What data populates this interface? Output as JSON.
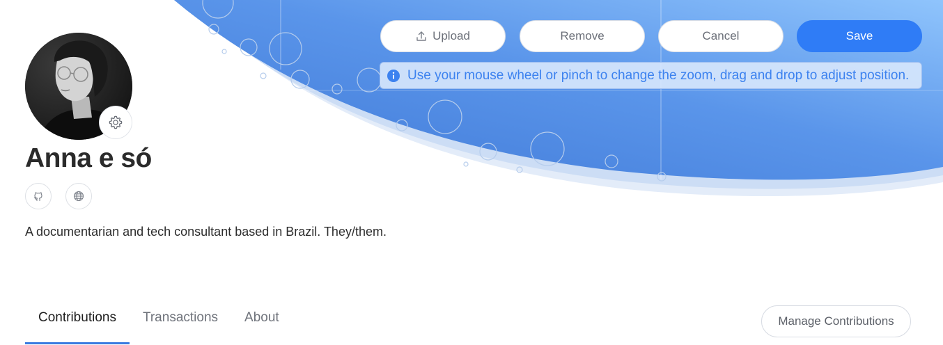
{
  "toolbar": {
    "upload_label": "Upload",
    "remove_label": "Remove",
    "cancel_label": "Cancel",
    "save_label": "Save"
  },
  "hint": {
    "text": "Use your mouse wheel or pinch to change the zoom, drag and drop to adjust position.",
    "icon": "info-icon"
  },
  "profile": {
    "name": "Anna e só",
    "bio": "A documentarian and tech consultant based in Brazil. They/them.",
    "links": [
      {
        "icon": "github-icon"
      },
      {
        "icon": "globe-icon"
      }
    ],
    "avatar_settings_icon": "gear-icon"
  },
  "tabs": [
    {
      "label": "Contributions",
      "active": true
    },
    {
      "label": "Transactions",
      "active": false
    },
    {
      "label": "About",
      "active": false
    }
  ],
  "manage_contributions_label": "Manage Contributions",
  "colors": {
    "accent": "#2f7cf6",
    "cover_gradient_start": "#4a84dc",
    "cover_gradient_end": "#8cc2fb"
  }
}
